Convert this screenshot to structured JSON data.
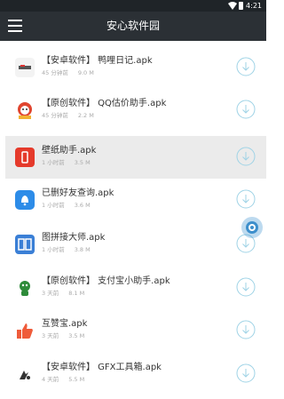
{
  "status_bar": {
    "time": "4:21"
  },
  "app_bar": {
    "title": "安心软件园"
  },
  "files": [
    {
      "name": "【安卓软件】 鸭哩日记.apk",
      "time": "45 分钟前",
      "size": "9.0 M",
      "icon": "android-app-icon"
    },
    {
      "name": "【原创软件】 QQ估价助手.apk",
      "time": "45 分钟前",
      "size": "2.2 M",
      "icon": "qq-valuation-icon"
    },
    {
      "name": "壁纸助手.apk",
      "time": "1 小时前",
      "size": "3.5 M",
      "icon": "wallpaper-icon"
    },
    {
      "name": "已删好友查询.apk",
      "time": "1 小时前",
      "size": "3.6 M",
      "icon": "bell-icon"
    },
    {
      "name": "图拼接大师.apk",
      "time": "1 小时前",
      "size": "3.8 M",
      "icon": "image-stitch-icon"
    },
    {
      "name": "【原创软件】 支付宝小助手.apk",
      "time": "3 天前",
      "size": "8.1 M",
      "icon": "alipay-helper-icon"
    },
    {
      "name": "互赞宝.apk",
      "time": "3 天前",
      "size": "3.5 M",
      "icon": "thumbs-up-icon"
    },
    {
      "name": "【安卓软件】 GFX工具箱.apk",
      "time": "4 天前",
      "size": "5.5 M",
      "icon": "gfx-tool-icon"
    }
  ],
  "colors": {
    "accent": "#9fd3e6",
    "appbar": "#2b3035",
    "statusbar": "#1f2428",
    "selected_row": "#ebebeb",
    "fab": "#3d8fcc"
  }
}
